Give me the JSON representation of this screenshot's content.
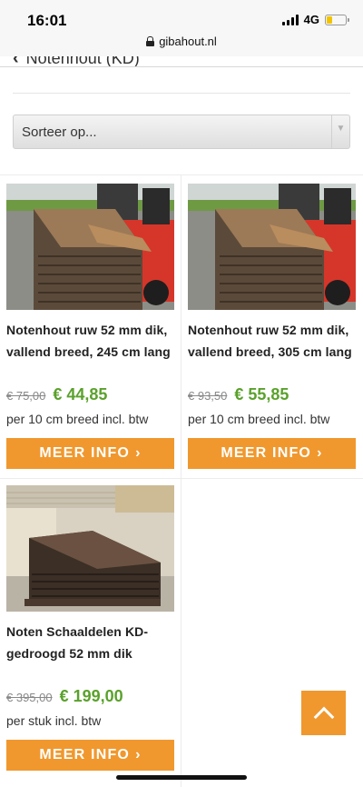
{
  "status": {
    "time": "16:01",
    "network": "4G",
    "battery_color": "#f2c400"
  },
  "browser": {
    "url": "gibahout.nl"
  },
  "header": {
    "back_label": "Notenhout (KD)"
  },
  "sort": {
    "label": "Sorteer op..."
  },
  "products": [
    {
      "title": "Notenhout ruw 52 mm dik, vallend breed, 245 cm lang",
      "old_price": "€ 75,00",
      "new_price": "€ 44,85",
      "unit": "per 10 cm breed incl. btw",
      "button": "MEER INFO"
    },
    {
      "title": "Notenhout ruw 52 mm dik, vallend breed, 305 cm lang",
      "old_price": "€ 93,50",
      "new_price": "€ 55,85",
      "unit": "per 10 cm breed incl. btw",
      "button": "MEER INFO"
    },
    {
      "title": "Noten Schaaldelen KD-gedroogd 52 mm dik",
      "old_price": "€ 395,00",
      "new_price": "€ 199,00",
      "unit": "per stuk incl. btw",
      "button": "MEER INFO"
    }
  ],
  "colors": {
    "accent": "#f0982e",
    "price": "#5aa12b"
  },
  "icons": {
    "back": "chevron-left-icon",
    "scroll_top": "chevron-up-icon",
    "button_arrow": "chevron-right-icon",
    "lock": "lock-icon"
  }
}
